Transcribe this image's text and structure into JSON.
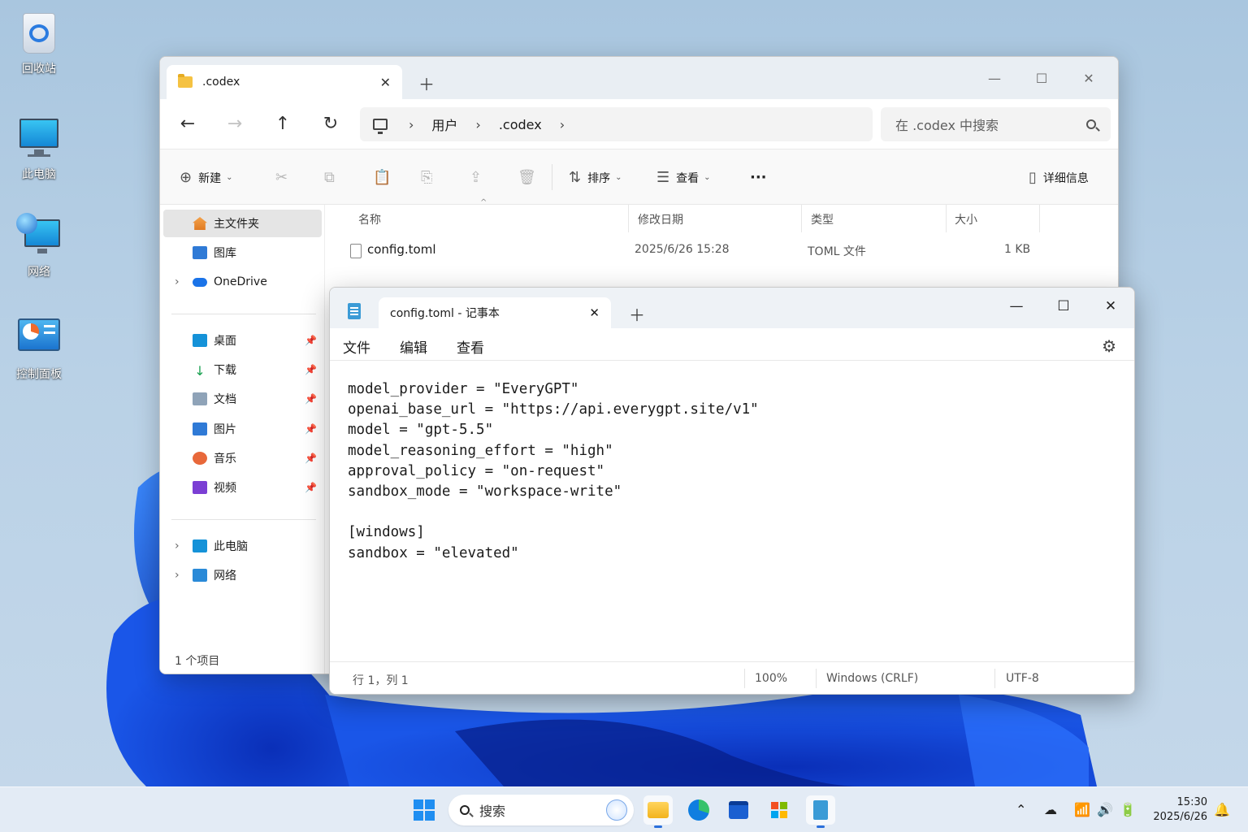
{
  "desktop": {
    "icons": [
      {
        "label": "回收站",
        "icon": "recycle-bin-icon"
      },
      {
        "label": "此电脑",
        "icon": "this-pc-icon"
      },
      {
        "label": "网络",
        "icon": "network-icon"
      },
      {
        "label": "控制面板",
        "icon": "control-panel-icon"
      }
    ]
  },
  "explorer": {
    "tab_title": ".codex",
    "breadcrumb": [
      "用户",
      ".codex"
    ],
    "search_placeholder": "在 .codex 中搜索",
    "toolbar": {
      "new_label": "新建",
      "sort_label": "排序",
      "view_label": "查看",
      "details_label": "详细信息"
    },
    "sidebar": {
      "home": "主文件夹",
      "gallery": "图库",
      "onedrive": "OneDrive",
      "pinned": [
        "桌面",
        "下载",
        "文档",
        "图片",
        "音乐",
        "视频"
      ],
      "this_pc": "此电脑",
      "network": "网络"
    },
    "columns": [
      "名称",
      "修改日期",
      "类型",
      "大小"
    ],
    "files": [
      {
        "name": "config.toml",
        "modified": "2025/6/26 15:28",
        "type": "TOML 文件",
        "size": "1 KB"
      }
    ],
    "status": "1 个项目"
  },
  "notepad": {
    "tab_title": "config.toml - 记事本",
    "menu": [
      "文件",
      "编辑",
      "查看"
    ],
    "content": "model_provider = \"EveryGPT\"\nopenai_base_url = \"https://api.everygpt.site/v1\"\nmodel = \"gpt-5.5\"\nmodel_reasoning_effort = \"high\"\napproval_policy = \"on-request\"\nsandbox_mode = \"workspace-write\"\n\n[windows]\nsandbox = \"elevated\"",
    "status": {
      "position": "行 1，列 1",
      "zoom": "100%",
      "line_ending": "Windows (CRLF)",
      "encoding": "UTF-8"
    }
  },
  "taskbar": {
    "search_label": "搜索",
    "time": "15:30",
    "date": "2025/6/26"
  },
  "colors": {
    "accent": "#2a6fdb",
    "folder": "#f5c242",
    "notepad_blue": "#3b9bd6"
  }
}
